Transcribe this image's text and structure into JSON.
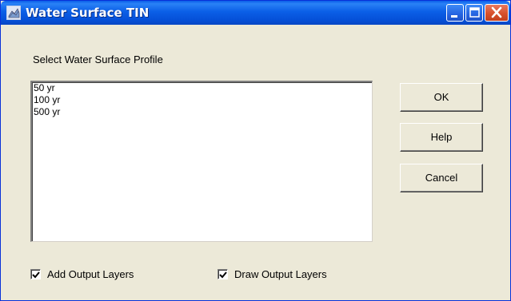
{
  "window": {
    "title": "Water Surface TIN",
    "controls": {
      "minimize": "minimize-icon",
      "maximize": "maximize-icon",
      "close": "close-icon"
    }
  },
  "dialog": {
    "select_label": "Select Water Surface Profile",
    "profiles": [
      "50 yr",
      "100 yr",
      "500 yr"
    ],
    "buttons": {
      "ok": "OK",
      "help": "Help",
      "cancel": "Cancel"
    },
    "options": {
      "add_output_layers": {
        "label": "Add Output Layers",
        "checked": true
      },
      "draw_output_layers": {
        "label": "Draw Output Layers",
        "checked": true
      }
    }
  },
  "colors": {
    "titlebar": "#0a5ee8",
    "dialog_bg": "#ece9d8",
    "close_button": "#d8502c"
  }
}
